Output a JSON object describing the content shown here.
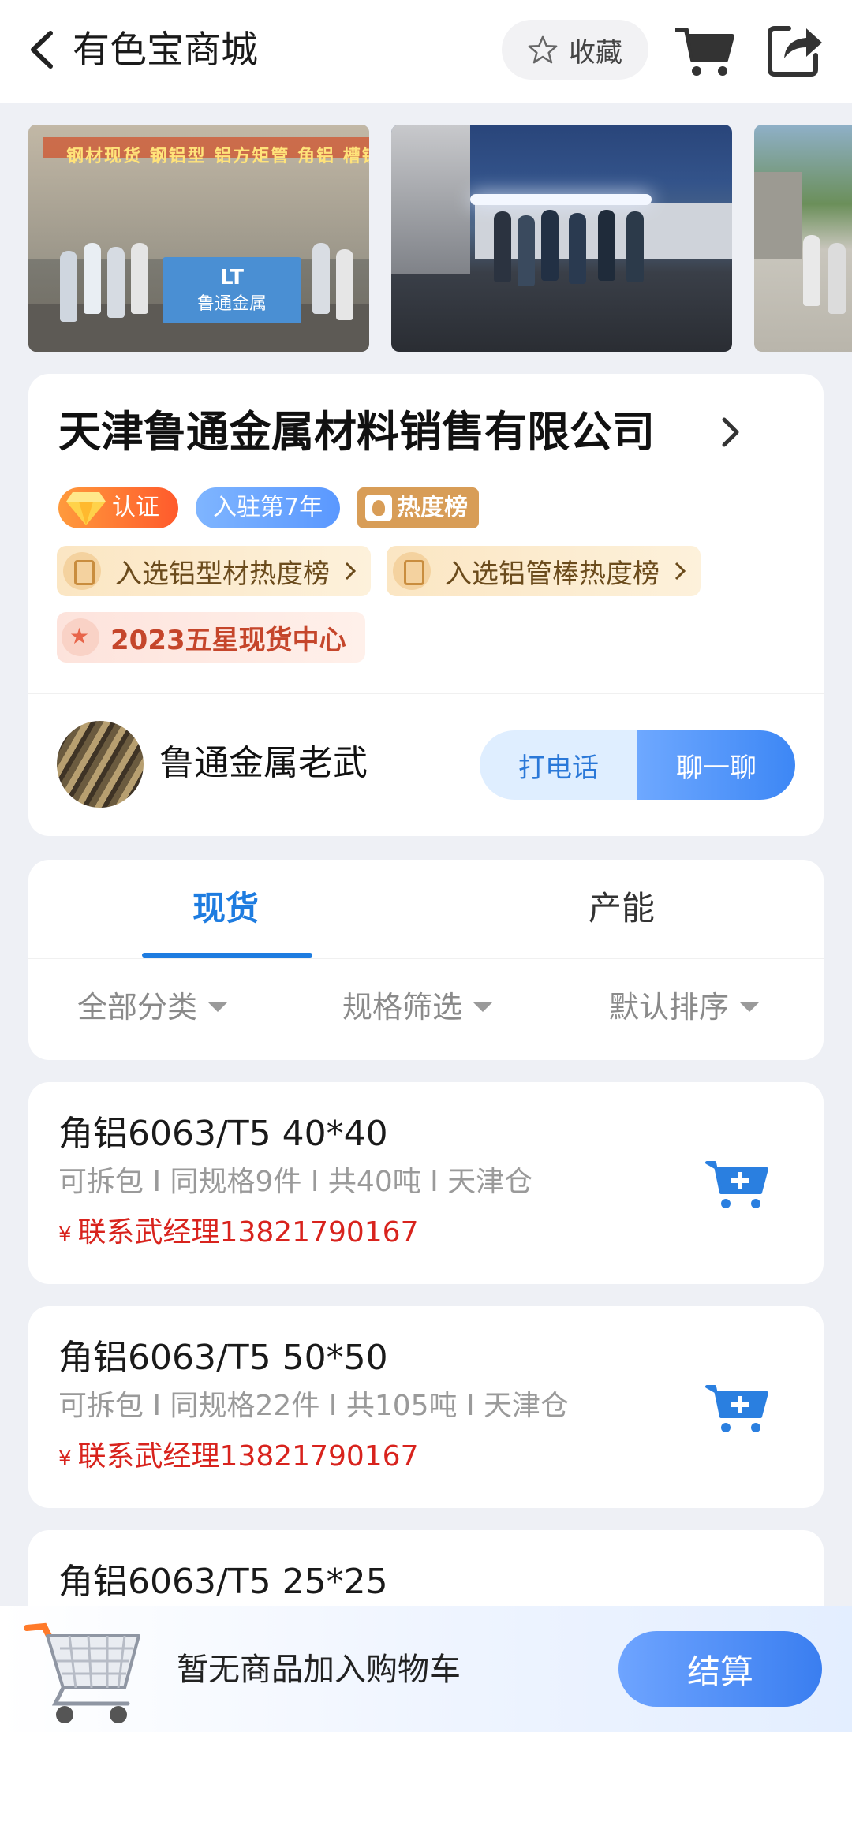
{
  "header": {
    "title": "有色宝商城",
    "favorite_label": "收藏",
    "icons": [
      "back-icon",
      "star-icon",
      "cart-icon",
      "share-icon"
    ]
  },
  "photos": {
    "photo1_sign": "钢材现货 钢铝型 铝方矩管 角铝 槽铝",
    "photo1_flag_line1": "LT",
    "photo1_flag_line2": "鲁通金属"
  },
  "company": {
    "name": "天津鲁通金属材料销售有限公司",
    "badges": {
      "certified": "认证",
      "years": "入驻第7年",
      "hot": "热度榜"
    },
    "rankings": [
      {
        "label": "入选铝型材热度榜"
      },
      {
        "label": "入选铝管棒热度榜"
      }
    ],
    "award": "2023五星现货中心",
    "contact_name": "鲁通金属老武",
    "call_label": "打电话",
    "chat_label": "聊一聊"
  },
  "tabs": {
    "stock": "现货",
    "capacity": "产能",
    "active": "stock"
  },
  "filters": {
    "category": "全部分类",
    "spec": "规格筛选",
    "sort": "默认排序"
  },
  "products": [
    {
      "title": "角铝6063/T5 40*40",
      "meta": "可拆包 I 同规格9件 I 共40吨 I 天津仓",
      "price_symbol": "¥",
      "price": "联系武经理13821790167"
    },
    {
      "title": "角铝6063/T5 50*50",
      "meta": "可拆包 I 同规格22件 I 共105吨 I 天津仓",
      "price_symbol": "¥",
      "price": "联系武经理13821790167"
    },
    {
      "title": "角铝6063/T5 25*25"
    }
  ],
  "cart_bar": {
    "empty_text": "暂无商品加入购物车",
    "checkout_label": "结算"
  },
  "colors": {
    "accent_blue": "#1e7ce0",
    "price_red": "#d8231d",
    "cert_orange": "#ff6a2c",
    "hot_gold": "#d89d57"
  }
}
